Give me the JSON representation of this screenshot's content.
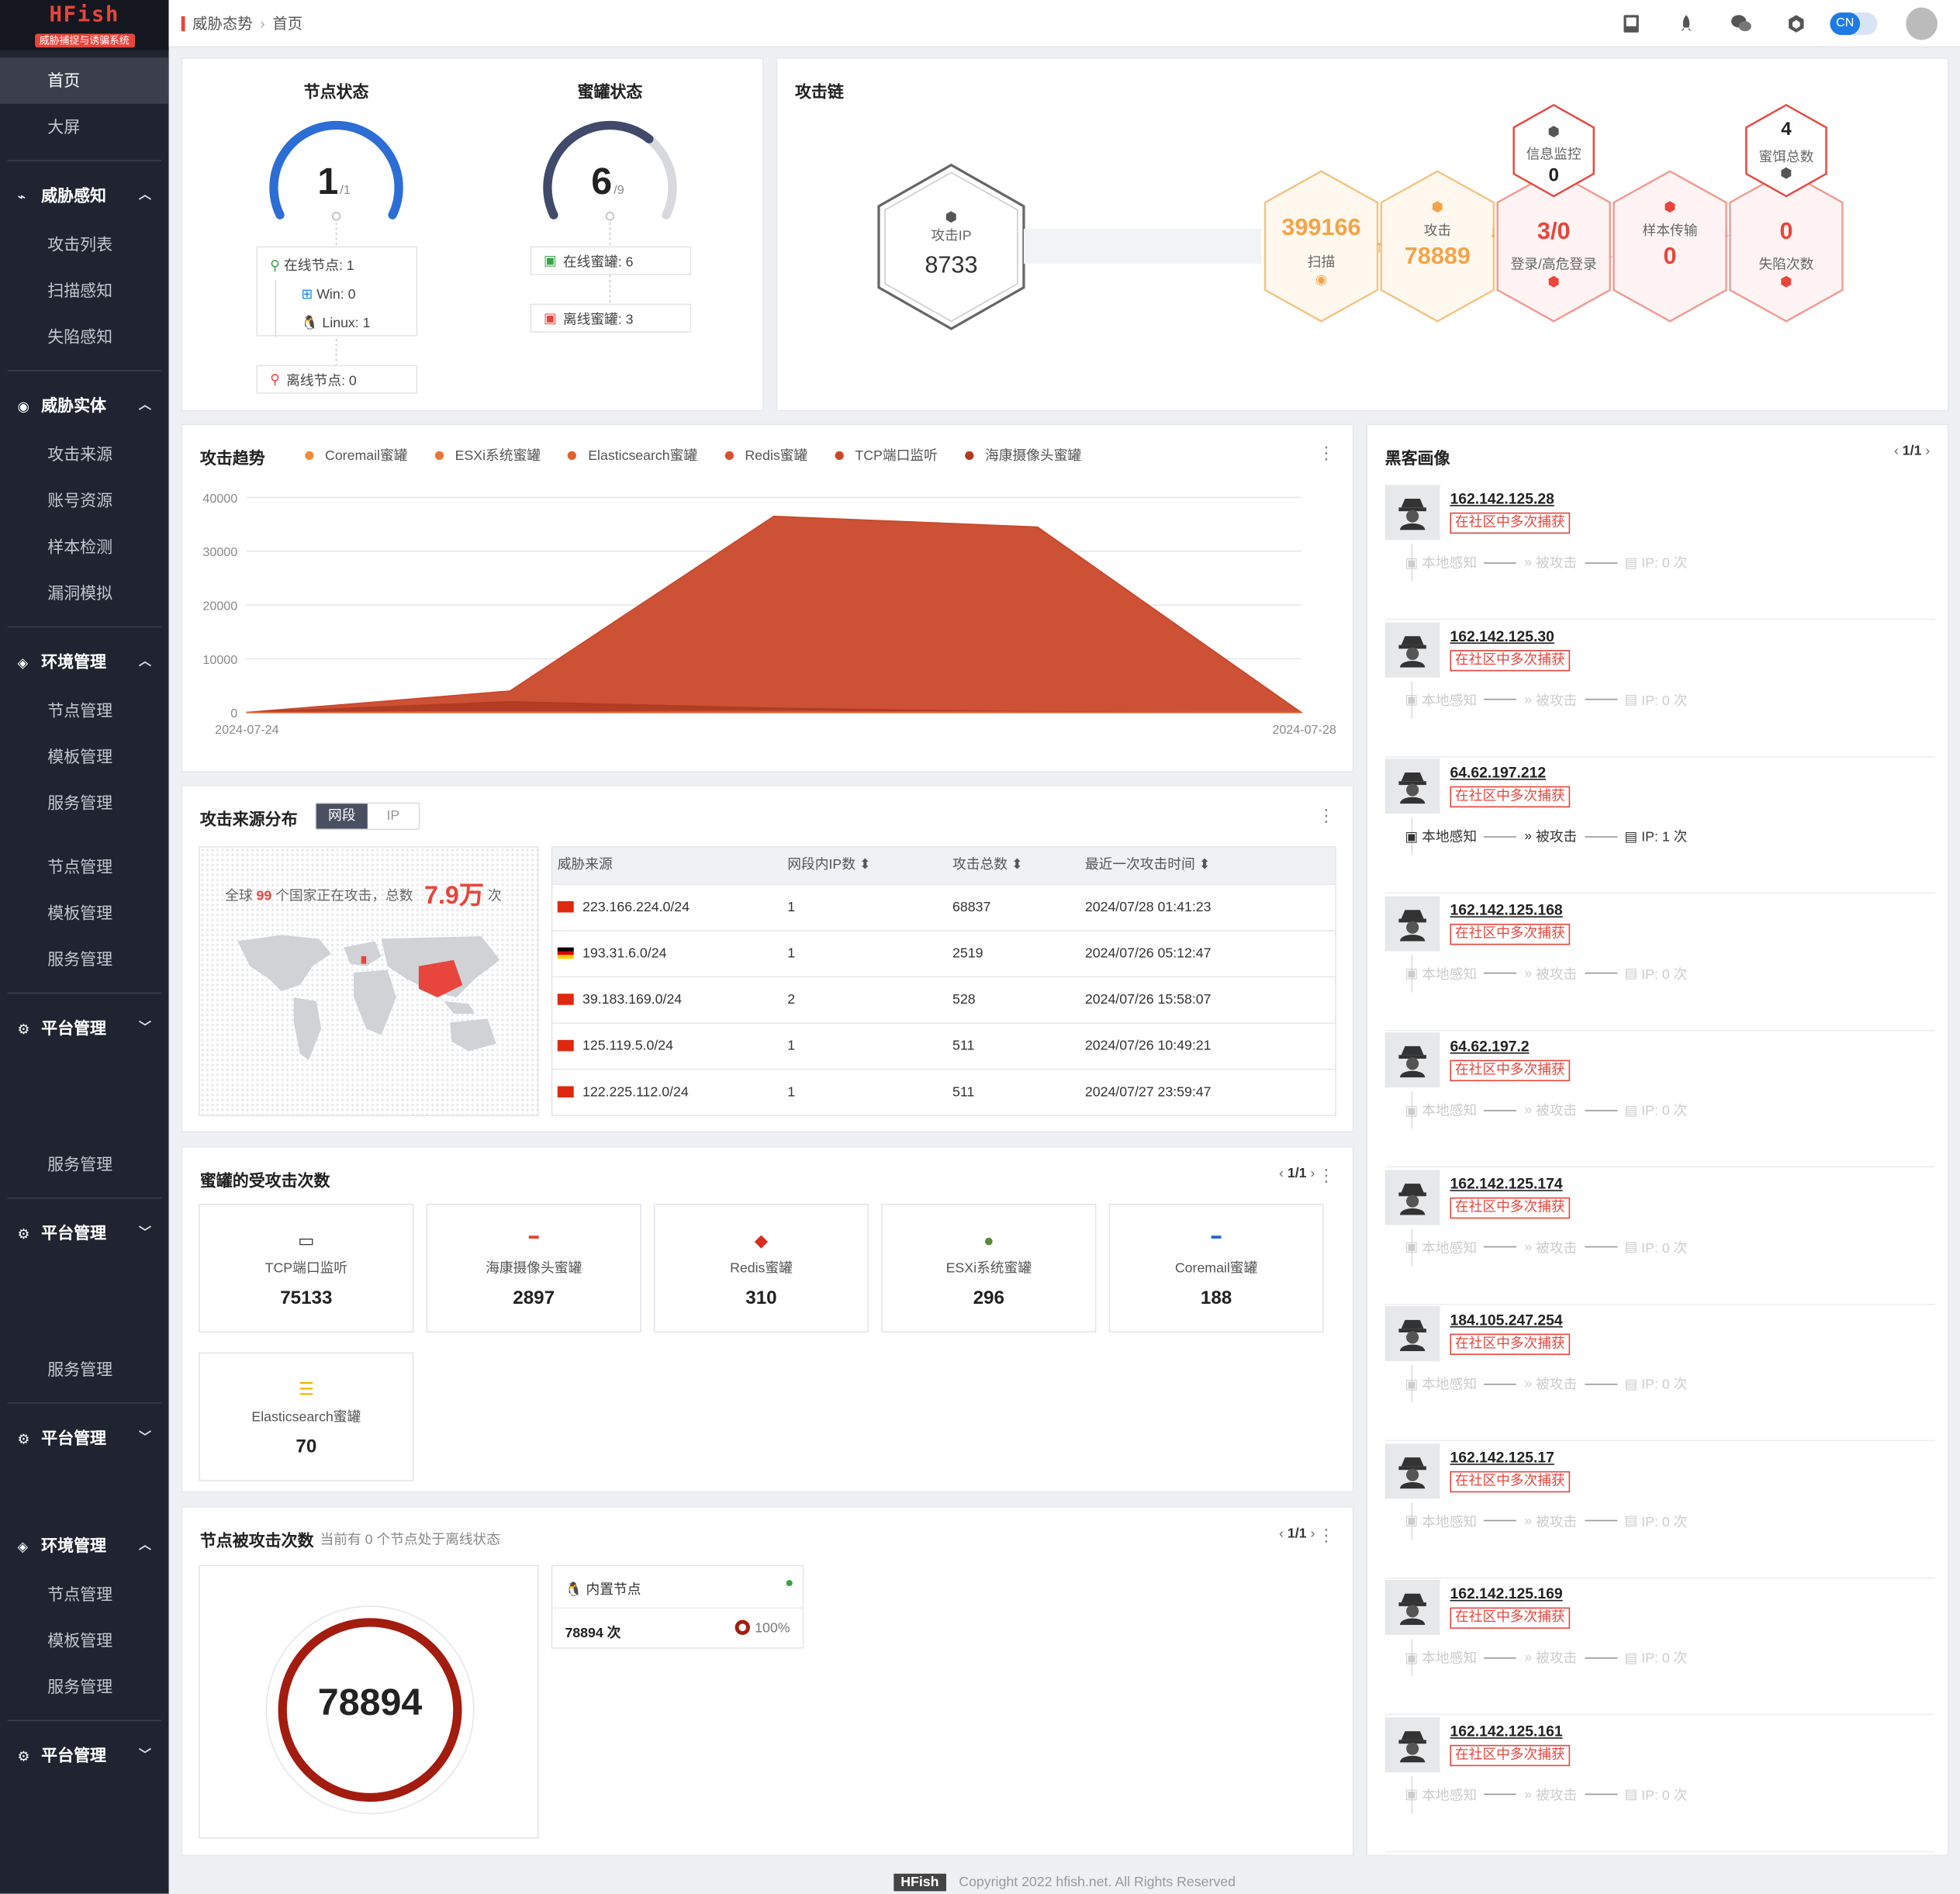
{
  "brand": {
    "name": "HFish",
    "subtitle": "威胁捕捉与诱骗系统"
  },
  "nav": {
    "home": "首页",
    "bigscreen": "大屏",
    "g1": {
      "title": "威胁感知",
      "items": [
        "攻击列表",
        "扫描感知",
        "失陷感知"
      ]
    },
    "g2": {
      "title": "威胁实体",
      "items": [
        "攻击来源",
        "账号资源",
        "样本检测",
        "漏洞模拟"
      ]
    },
    "g3": {
      "title": "环境管理",
      "items": [
        "节点管理",
        "模板管理",
        "服务管理"
      ]
    },
    "g3b": {
      "items": [
        "节点管理",
        "模板管理",
        "服务管理"
      ]
    },
    "g4": {
      "title": "平台管理"
    },
    "svc1": "服务管理",
    "g5": {
      "title": "平台管理"
    },
    "svc2": "服务管理",
    "g6": {
      "title": "平台管理"
    },
    "g7": {
      "title": "环境管理",
      "items": [
        "节点管理",
        "模板管理",
        "服务管理"
      ]
    },
    "g8": {
      "title": "平台管理"
    }
  },
  "breadcrumb": {
    "parent": "威胁态势",
    "current": "首页"
  },
  "topbar": {
    "lang": "CN",
    "icons": [
      "manual-icon",
      "rocket-icon",
      "wechat-icon",
      "cube-icon"
    ]
  },
  "node_status": {
    "title": "节点状态",
    "value": "1",
    "total": "/1",
    "online": "在线节点: 1",
    "win": "Win: 0",
    "linux": "Linux: 1",
    "offline": "离线节点: 0",
    "ratio": 1.0
  },
  "honeypot_status": {
    "title": "蜜罐状态",
    "value": "6",
    "total": "/9",
    "online": "在线蜜罐: 6",
    "offline": "离线蜜罐: 3",
    "ratio": 0.667
  },
  "attack_chain": {
    "title": "攻击链",
    "attack_ip_label": "攻击IP",
    "attack_ip": "8733",
    "scan_value": "399166",
    "scan_label": "扫描",
    "attack_label": "攻击",
    "attack_value": "78889",
    "info_label": "信息监控",
    "info_value": "0",
    "login_value": "3/0",
    "login_label": "登录/高危登录",
    "sample_label": "样本传输",
    "sample_value": "0",
    "honey_total_value": "4",
    "honey_total_label": "蜜饵总数",
    "fall_value": "0",
    "fall_label": "失陷次数"
  },
  "trend": {
    "title": "攻击趋势"
  },
  "chart_data": {
    "type": "area",
    "title": "攻击趋势",
    "x": [
      "2024-07-24",
      "2024-07-25",
      "2024-07-26",
      "2024-07-27",
      "2024-07-28"
    ],
    "x_tick_labels": [
      "2024-07-24",
      "2024-07-28"
    ],
    "ylim": [
      0,
      40000
    ],
    "y_ticks": [
      "40000",
      "30000",
      "20000",
      "10000",
      "0"
    ],
    "grid": true,
    "legend_position": "top",
    "series": [
      {
        "name": "Coremail蜜罐",
        "color": "#f08a3a",
        "values": [
          0,
          100,
          150,
          50,
          0
        ]
      },
      {
        "name": "ESXi系统蜜罐",
        "color": "#e8753a",
        "values": [
          0,
          100,
          150,
          50,
          0
        ]
      },
      {
        "name": "Elasticsearch蜜罐",
        "color": "#e0612f",
        "values": [
          0,
          20,
          30,
          20,
          0
        ]
      },
      {
        "name": "Redis蜜罐",
        "color": "#d9502e",
        "values": [
          0,
          100,
          150,
          60,
          0
        ]
      },
      {
        "name": "TCP端口监听",
        "color": "#c9482a",
        "values": [
          0,
          4000,
          36500,
          34500,
          0
        ]
      },
      {
        "name": "海康摄像头蜜罐",
        "color": "#b03a22",
        "values": [
          0,
          2000,
          800,
          100,
          0
        ]
      }
    ]
  },
  "source": {
    "title": "攻击来源分布",
    "tab_segment": "网段",
    "tab_ip": "IP",
    "summary_prefix": "全球",
    "countries": "99",
    "summary_mid": "个国家正在攻击，总数",
    "total": "7.9万",
    "summary_suffix": "次",
    "headers": [
      "威胁来源",
      "网段内IP数",
      "攻击总数",
      "最近一次攻击时间"
    ],
    "rows": [
      {
        "flag": "cn",
        "src": "223.166.224.0/24",
        "ips": "1",
        "total": "68837",
        "time": "2024/07/28 01:41:23"
      },
      {
        "flag": "de",
        "src": "193.31.6.0/24",
        "ips": "1",
        "total": "2519",
        "time": "2024/07/26 05:12:47"
      },
      {
        "flag": "cn",
        "src": "39.183.169.0/24",
        "ips": "2",
        "total": "528",
        "time": "2024/07/26 15:58:07"
      },
      {
        "flag": "cn",
        "src": "125.119.5.0/24",
        "ips": "1",
        "total": "511",
        "time": "2024/07/26 10:49:21"
      },
      {
        "flag": "cn",
        "src": "122.225.112.0/24",
        "ips": "1",
        "total": "511",
        "time": "2024/07/27 23:59:47"
      }
    ]
  },
  "honeypots": {
    "title": "蜜罐的受攻击次数",
    "pager": "1/1",
    "items": [
      {
        "name": "TCP端口监听",
        "value": "75133",
        "icon": "port-icon"
      },
      {
        "name": "海康摄像头蜜罐",
        "value": "2897",
        "icon": "hikvision-icon"
      },
      {
        "name": "Redis蜜罐",
        "value": "310",
        "icon": "redis-icon"
      },
      {
        "name": "ESXi系统蜜罐",
        "value": "296",
        "icon": "vmware-icon"
      },
      {
        "name": "Coremail蜜罐",
        "value": "188",
        "icon": "coremail-icon"
      },
      {
        "name": "Elasticsearch蜜罐",
        "value": "70",
        "icon": "elasticsearch-icon"
      }
    ]
  },
  "node_attacks": {
    "title": "节点被攻击次数",
    "subtitle": "当前有 0 个节点处于离线状态",
    "pager": "1/1",
    "total": "78894",
    "node_name": "内置节点",
    "node_count": "78894 次",
    "node_pct": "100%"
  },
  "hackers": {
    "title": "黑客画像",
    "pager": "1/1",
    "tag": "在社区中多次捕获",
    "local": "本地感知",
    "attacked": "被攻击",
    "items": [
      {
        "ip": "162.142.125.28",
        "count": "IP: 0 次",
        "active": false
      },
      {
        "ip": "162.142.125.30",
        "count": "IP: 0 次",
        "active": false
      },
      {
        "ip": "64.62.197.212",
        "count": "IP: 1 次",
        "active": true
      },
      {
        "ip": "162.142.125.168",
        "count": "IP: 0 次",
        "active": false
      },
      {
        "ip": "64.62.197.2",
        "count": "IP: 0 次",
        "active": false
      },
      {
        "ip": "162.142.125.174",
        "count": "IP: 0 次",
        "active": false
      },
      {
        "ip": "184.105.247.254",
        "count": "IP: 0 次",
        "active": false
      },
      {
        "ip": "162.142.125.17",
        "count": "IP: 0 次",
        "active": false
      },
      {
        "ip": "162.142.125.169",
        "count": "IP: 0 次",
        "active": false
      },
      {
        "ip": "162.142.125.161",
        "count": "IP: 0 次",
        "active": false
      }
    ]
  },
  "footer": {
    "brand": "HFish",
    "copyright": "Copyright 2022 hfish.net. All Rights Reserved"
  }
}
